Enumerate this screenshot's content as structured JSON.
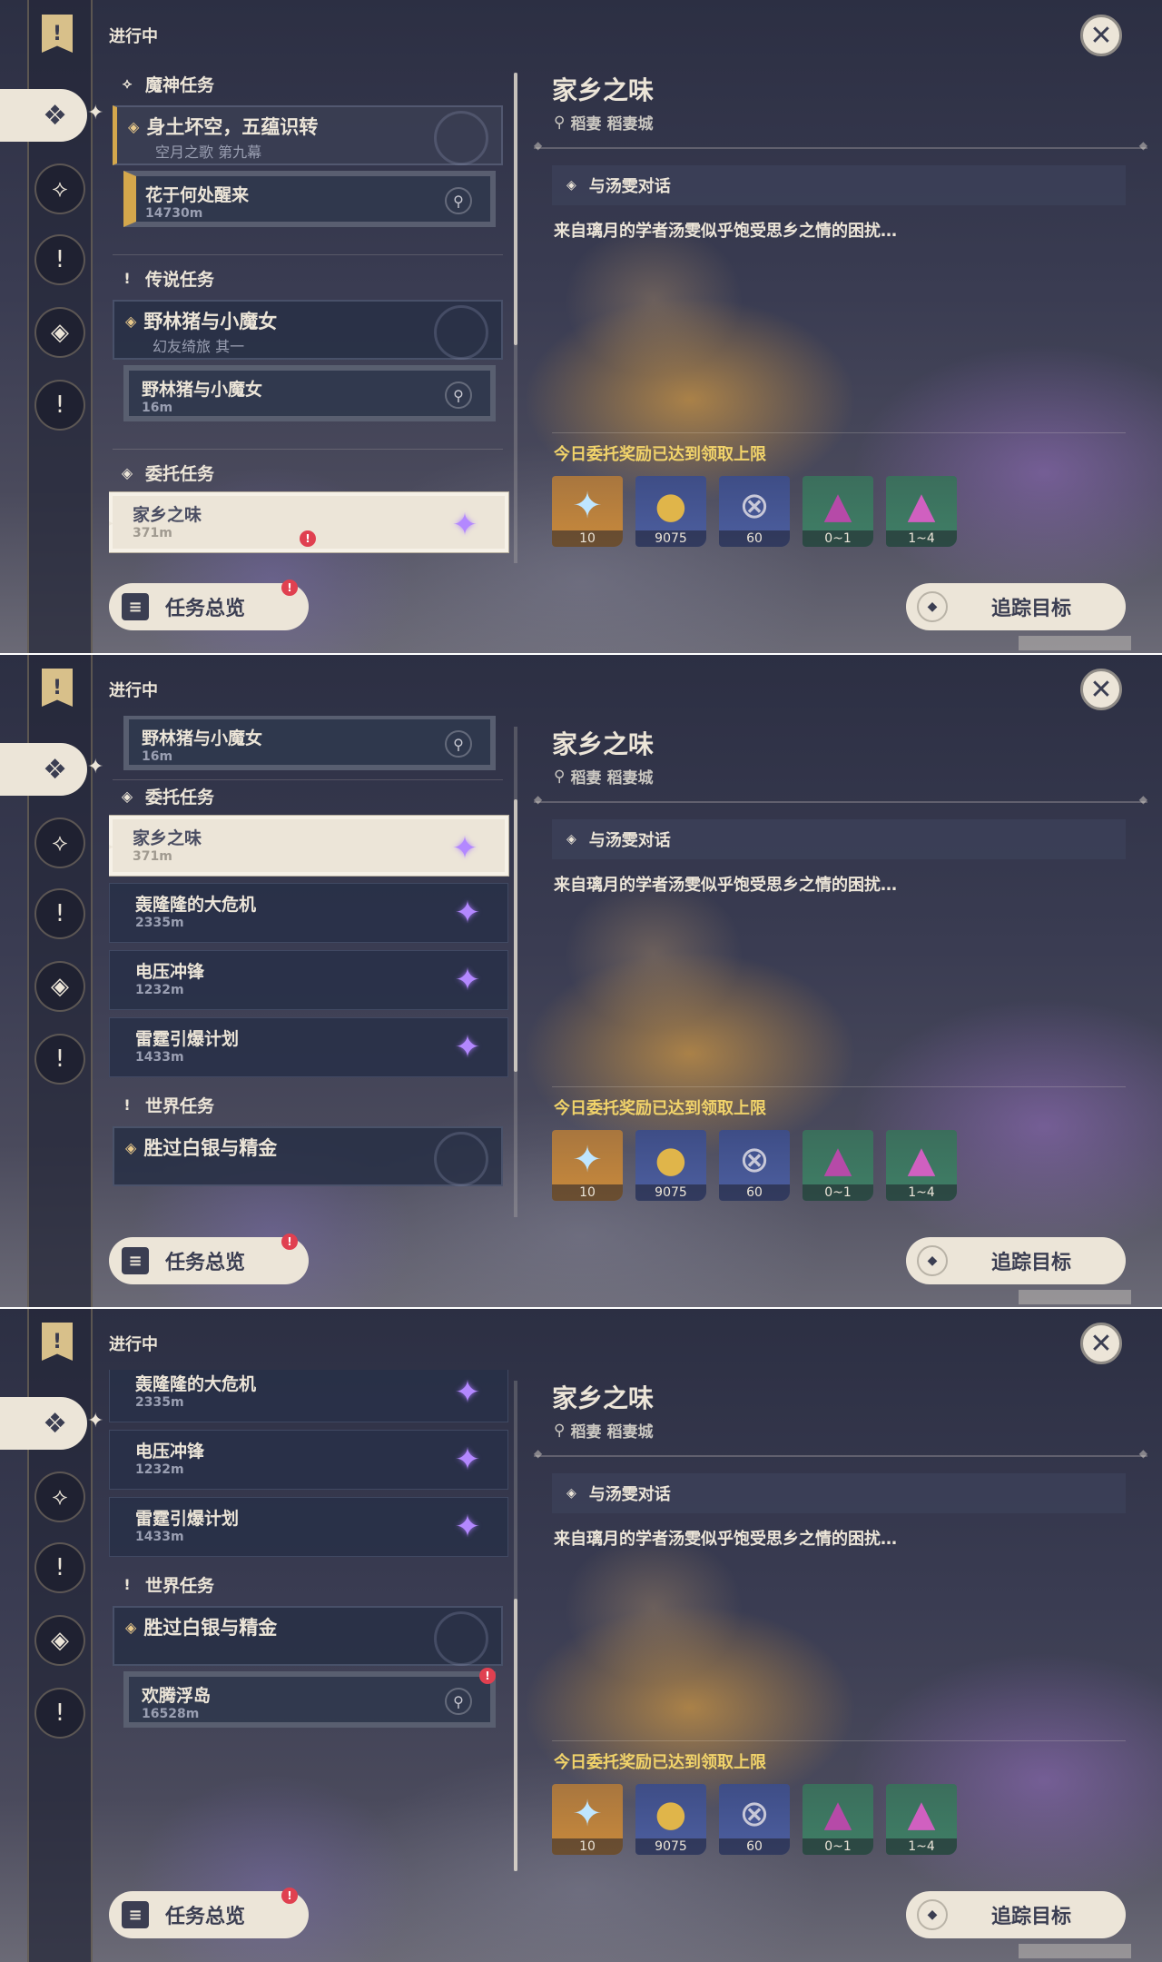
{
  "status_label": "进行中",
  "close_glyph": "✕",
  "rail_book_glyph": "!",
  "categories": {
    "archon": "魔神任务",
    "legend": "传说任务",
    "commission": "委托任务",
    "world": "世界任务"
  },
  "archon_quest": {
    "title": "身土坏空，五蕴识转",
    "subtitle": "空月之歌 第九幕"
  },
  "archon_step": {
    "title": "花于何处醒来",
    "distance": "14730m"
  },
  "legend_quest": {
    "title": "野林猪与小魔女",
    "subtitle": "幻友绮旅 其一"
  },
  "legend_step": {
    "title": "野林猪与小魔女",
    "distance": "16m"
  },
  "commissions": [
    {
      "title": "家乡之味",
      "distance": "371m"
    },
    {
      "title": "轰隆隆的大危机",
      "distance": "2335m"
    },
    {
      "title": "电压冲锋",
      "distance": "1232m"
    },
    {
      "title": "雷霆引爆计划",
      "distance": "1433m"
    }
  ],
  "world_quest": {
    "title": "胜过白银与精金"
  },
  "world_step": {
    "title": "欢腾浮岛",
    "distance": "16528m"
  },
  "buttons": {
    "overview": "任务总览",
    "track": "追踪目标"
  },
  "notif_mark": "!",
  "detail": {
    "title": "家乡之味",
    "region": "稻妻",
    "city": "稻妻城",
    "objective": "与汤雯对话",
    "description": "来自璃月的学者汤雯似乎饱受思乡之情的困扰…",
    "reward_note": "今日委托奖励已达到领取上限",
    "rewards": [
      {
        "name": "primogem-icon",
        "count": "10",
        "color": "#c98a3c"
      },
      {
        "name": "mora-icon",
        "count": "9075",
        "color": "#4d5fa0"
      },
      {
        "name": "fate-icon",
        "count": "60",
        "color": "#4d5fa0"
      },
      {
        "name": "ore-icon",
        "count": "0~1",
        "color": "#3f7f66"
      },
      {
        "name": "crystal-icon",
        "count": "1~4",
        "color": "#3f7f66"
      }
    ]
  }
}
